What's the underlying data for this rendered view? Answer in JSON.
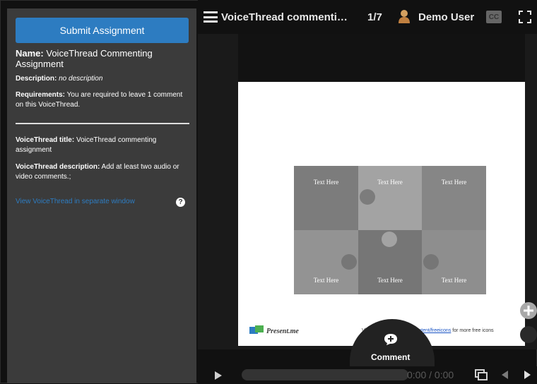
{
  "sidebar": {
    "submit_label": "Submit Assignment",
    "name_label": "Name:",
    "name_value": "VoiceThread Commenting Assignment",
    "description_label": "Description:",
    "description_value": "no description",
    "requirements_label": "Requirements:",
    "requirements_value": "You are required to leave 1 comment on this VoiceThread.",
    "vt_title_label": "VoiceThread title:",
    "vt_title_value": "VoiceThread commenting assignment",
    "vt_description_label": "VoiceThread description:",
    "vt_description_value": "Add at least two audio or video comments.;",
    "view_link": "View VoiceThread in separate window",
    "help_icon": "?"
  },
  "topbar": {
    "title": "VoiceThread commenti…",
    "page_count": "1/7",
    "user_name": "Demo User",
    "cc_label": "CC"
  },
  "slide": {
    "pieces": [
      "Text Here",
      "Text Here",
      "Text Here",
      "Text Here",
      "Text Here",
      "Text Here"
    ],
    "logo_text": "Present.me",
    "footer_prefix": "Visit ",
    "footer_link": "https://present.me/content/freeicons",
    "footer_suffix": " for more free icons"
  },
  "comment": {
    "label": "Comment"
  },
  "player": {
    "time": "0:00 / 0:00"
  },
  "colors": {
    "accent": "#2d7cc1",
    "sidebar_bg": "#3b3b3b",
    "stage_bg": "#111111"
  }
}
